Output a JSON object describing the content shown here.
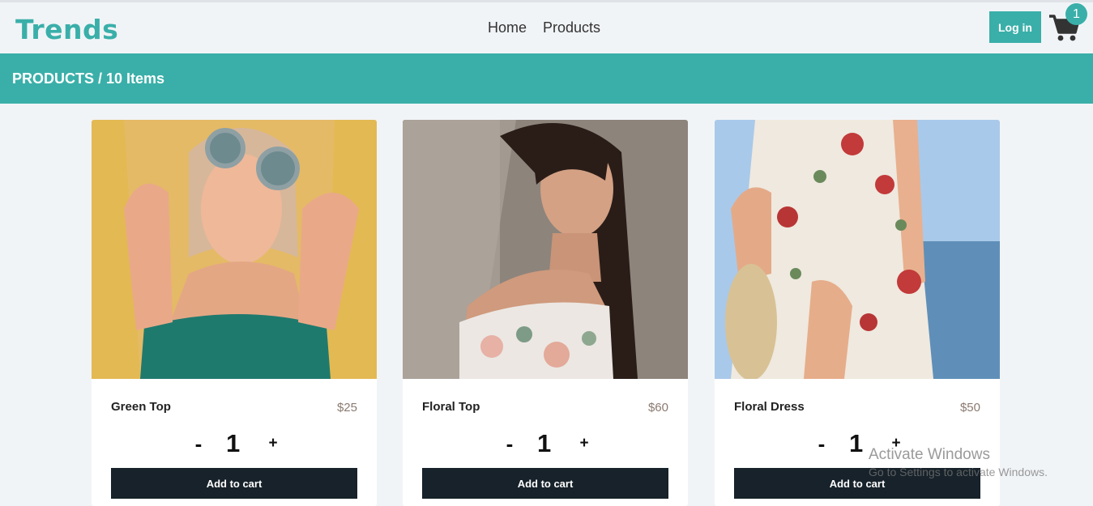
{
  "brand": {
    "logo": "Trends",
    "accent_color": "#3aafa9"
  },
  "nav": {
    "links": [
      "Home",
      "Products"
    ],
    "login_label": "Log in",
    "cart_icon": "shopping-cart-icon",
    "cart_count": "1"
  },
  "banner": {
    "title": "PRODUCTS / 10 Items"
  },
  "products": [
    {
      "name": "Green Top",
      "price": "$25",
      "quantity": "1",
      "minus": "-",
      "plus": "+",
      "add_label": "Add to cart",
      "image": "woman-green-top-photo"
    },
    {
      "name": "Floral Top",
      "price": "$60",
      "quantity": "1",
      "minus": "-",
      "plus": "+",
      "add_label": "Add to cart",
      "image": "woman-floral-top-photo"
    },
    {
      "name": "Floral Dress",
      "price": "$50",
      "quantity": "1",
      "minus": "-",
      "plus": "+",
      "add_label": "Add to cart",
      "image": "woman-floral-dress-photo"
    }
  ],
  "watermark": {
    "title": "Activate Windows",
    "subtitle": "Go to Settings to activate Windows."
  }
}
